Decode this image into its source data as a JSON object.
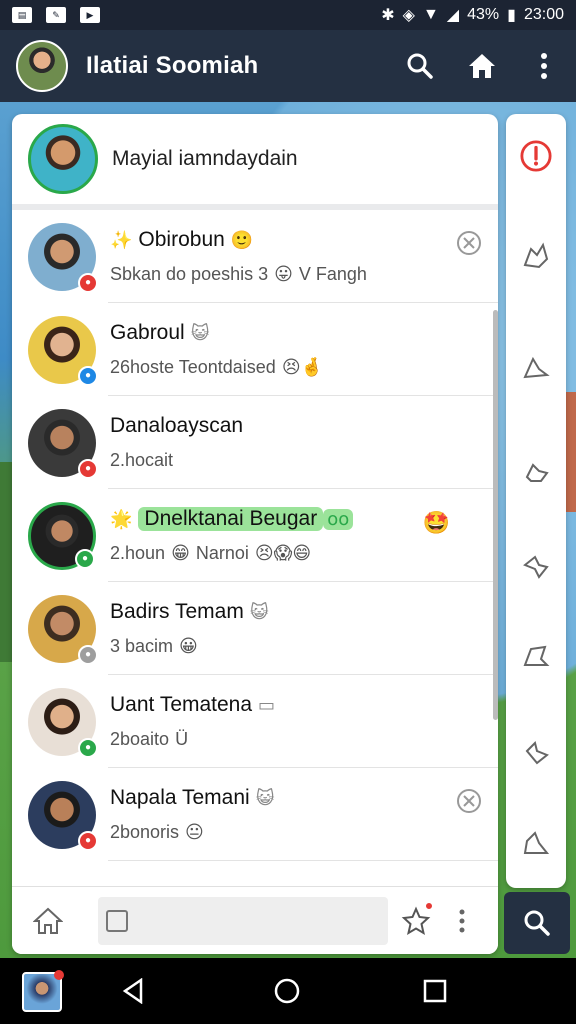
{
  "status_bar": {
    "battery": "43%",
    "time": "23:00"
  },
  "app_bar": {
    "title": "Ilatiai Soomiah"
  },
  "profile": {
    "name": "Mayial iamndaydain"
  },
  "chats": [
    {
      "name": "Obirobun",
      "prefix_emoji": "✨",
      "suffix_emoji": "🙂",
      "message": "Sbkan do poeshis 3",
      "msg_emoji": "😛",
      "msg_suffix": "V Fangh",
      "badge_color": "#e53935",
      "avatar_colors": [
        "#d09a72",
        "#2a2a2a",
        "#7faecf"
      ],
      "close": true,
      "highlight": false
    },
    {
      "name": "Gabroul",
      "suffix_emoji": "😺",
      "message": "26hoste Teontdaised",
      "msg_emoji": "😣🤞",
      "badge_color": "#1e88e5",
      "avatar_colors": [
        "#e1b390",
        "#3a2418",
        "#e9c84a"
      ],
      "close": false,
      "highlight": false
    },
    {
      "name": "Danaloayscan",
      "message": "2.hocait",
      "badge_color": "#e53935",
      "avatar_colors": [
        "#b8825e",
        "#2a2a2a",
        "#3a3a3a"
      ],
      "close": false,
      "highlight": false
    },
    {
      "name": "Dnelktanai Beugar",
      "prefix_emoji": "🌟",
      "suffix_emoji": "oo",
      "right_emoji": "🤩",
      "message": "2.houn",
      "msg_emoji": "😁",
      "msg_suffix": "Narnoi",
      "msg_emoji2": "😣😱😄",
      "badge_color": "#2aa84a",
      "avatar_colors": [
        "#c08863",
        "#2a2a2a",
        "#1f1f1f"
      ],
      "close": false,
      "highlight": true
    },
    {
      "name": "Badirs Temam",
      "suffix_emoji": "😺",
      "message": "3 bacim",
      "msg_emoji": "😀",
      "badge_color": "#9e9e9e",
      "avatar_colors": [
        "#c28b66",
        "#3d2d20",
        "#d7a84a"
      ],
      "close": false,
      "highlight": false
    },
    {
      "name": "Uant Tematena",
      "suffix_emoji": "▭",
      "message": "2boaito",
      "msg_suffix": "Ü",
      "badge_color": "#2aa84a",
      "avatar_colors": [
        "#e0b08a",
        "#2c1d15",
        "#e8dfd6"
      ],
      "close": false,
      "highlight": false
    },
    {
      "name": "Napala Temani",
      "suffix_emoji": "😺",
      "message": "2bonoris",
      "msg_emoji": "😐",
      "badge_color": "#e53935",
      "avatar_colors": [
        "#b98059",
        "#1b1b1b",
        "#2c3d5e"
      ],
      "close": true,
      "highlight": false
    }
  ],
  "icons": {
    "search": "search-icon",
    "home": "home-icon",
    "more": "more-vert-icon",
    "alert": "alert-icon",
    "star": "star-icon"
  },
  "colors": {
    "app_bar": "#243042",
    "status_bar": "#1c2433",
    "alert_red": "#e53935",
    "highlight_green": "#9be39a"
  }
}
